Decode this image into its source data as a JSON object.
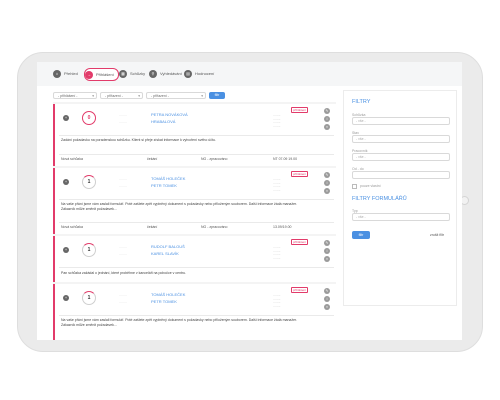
{
  "tabs": [
    {
      "label": "Přehled",
      "icon": "home-icon",
      "glyph": "⌂"
    },
    {
      "label": "Přihlášení",
      "icon": "login-icon",
      "glyph": "→"
    },
    {
      "label": "Schůzky",
      "icon": "calendar-icon",
      "glyph": "▦"
    },
    {
      "label": "Vyhledávání",
      "icon": "search-icon",
      "glyph": "⚲"
    },
    {
      "label": "Hodnocení",
      "icon": "chart-icon",
      "glyph": "▤"
    }
  ],
  "filters": {
    "selects": [
      "- přihlášení -",
      "- přiřazení -",
      "- přiřazení -"
    ],
    "apply_label": "filtr"
  },
  "cards": [
    {
      "count": "0",
      "ring": "red",
      "badge": "přihlášení",
      "name1": "PETRA NOVÁKOVÁ",
      "name2": "HRABALOVÁ",
      "desc": "Zadání požadavku na poradenskou schůzku. Klient si přeje získat informace k vytvoření svého účtu.",
      "row": [
        "Nová schůzka",
        "čekání",
        "NG - zpracováno",
        "NT 07.09 19.00"
      ]
    },
    {
      "count": "1",
      "ring": "gray",
      "badge": "přihlášení",
      "name1": "TOMÁŠ HOLEČEK",
      "name2": "PETR TOMEK",
      "desc": "Na vaše přání jsme vám zaslali formulář. Poté zašlete zpět vyplněný dokument s požadavky nebo přiloženým souborem. Další informace žádá manažer. Zákazník může změnit požadavek...",
      "row": [
        "Nová schůzka",
        "čekání",
        "NG - zpracováno",
        "13.09/19.00"
      ]
    },
    {
      "count": "1",
      "ring": "gray",
      "badge": "přihlášení",
      "name1": "RUDOLF BALOUŠ",
      "name2": "KAREL SLAVÍK",
      "desc": "Pan schůzka zažádal o jednání, které proběhne v kanceláři na pobočce v centru.",
      "row": [
        "",
        "",
        "",
        ""
      ]
    },
    {
      "count": "1",
      "ring": "gray",
      "badge": "přihlášení",
      "name1": "TOMÁŠ HOLEČEK",
      "name2": "PETR TOMEK",
      "desc": "Na vaše přání jsme vám zaslali formulář. Poté zašlete zpět vyplněný dokument s požadavky nebo přiloženým souborem. Další informace žádá manažer. Zákazník může změnit požadavek...",
      "row": [
        "",
        "",
        "",
        ""
      ]
    }
  ],
  "panel": {
    "title": "FILTRY",
    "fields": [
      {
        "label": "Schůzka",
        "placeholder": "- vše -"
      },
      {
        "label": "Stav",
        "placeholder": "- vše -"
      },
      {
        "label": "Pracovník",
        "placeholder": "- vše -"
      },
      {
        "label": "Od - do",
        "placeholder": ""
      }
    ],
    "check_label": "pouze vlastní",
    "title2": "FILTRY FORMULÁŘŮ",
    "field2": {
      "label": "Typ",
      "placeholder": "- vše -"
    },
    "filter_label": "filtr",
    "reset_label": "zrušit filtr"
  }
}
